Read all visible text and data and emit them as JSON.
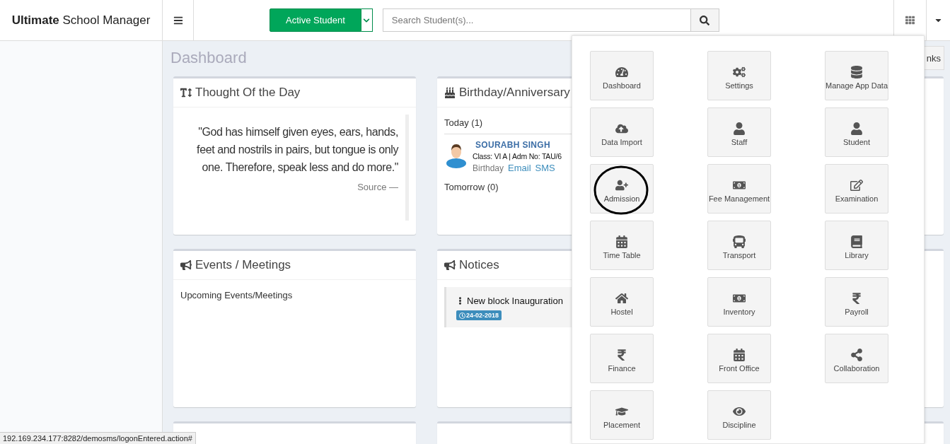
{
  "brand": {
    "bold": "Ultimate",
    "rest": "School Manager"
  },
  "header": {
    "mode_button": "Active Student",
    "search": {
      "placeholder": "Search Student(s)..."
    }
  },
  "page": {
    "title": "Dashboard",
    "links_button": "nks"
  },
  "thought": {
    "title": "Thought Of the Day",
    "quote": "\"God has himself given eyes, ears, hands, feet and nostrils in pairs, but tongue is only one. Therefore, speak less and do more.\"",
    "source": "Source —"
  },
  "birthday": {
    "title": "Birthday/Anniversary",
    "today": "Today (1)",
    "person": {
      "name": "SOURABH SINGH",
      "details": "Class: VI A | Adm No: TAU/6",
      "type": "Birthday",
      "links": [
        "Email",
        "SMS"
      ]
    },
    "tomorrow": "Tomorrow (0)"
  },
  "events": {
    "title": "Events / Meetings",
    "subtitle": "Upcoming Events/Meetings"
  },
  "notices": {
    "title": "Notices",
    "items": [
      {
        "title": "New block Inauguration",
        "date": "24-02-2018"
      }
    ]
  },
  "modules": [
    {
      "label": "Dashboard",
      "annotated": false
    },
    {
      "label": "Settings",
      "annotated": false
    },
    {
      "label": "Manage App Data",
      "annotated": false
    },
    {
      "label": "Data Import",
      "annotated": false
    },
    {
      "label": "Staff",
      "annotated": false
    },
    {
      "label": "Student",
      "annotated": false
    },
    {
      "label": "Admission",
      "annotated": true
    },
    {
      "label": "Fee Management",
      "annotated": false
    },
    {
      "label": "Examination",
      "annotated": false
    },
    {
      "label": "Time Table",
      "annotated": false
    },
    {
      "label": "Transport",
      "annotated": false
    },
    {
      "label": "Library",
      "annotated": false
    },
    {
      "label": "Hostel",
      "annotated": false
    },
    {
      "label": "Inventory",
      "annotated": false
    },
    {
      "label": "Payroll",
      "annotated": false
    },
    {
      "label": "Finance",
      "annotated": false
    },
    {
      "label": "Front Office",
      "annotated": false
    },
    {
      "label": "Collaboration",
      "annotated": false
    },
    {
      "label": "Placement",
      "annotated": false
    },
    {
      "label": "Discipline",
      "annotated": false
    }
  ],
  "status_bar": "192.169.234.177:8282/demosms/logonEntered.action#"
}
